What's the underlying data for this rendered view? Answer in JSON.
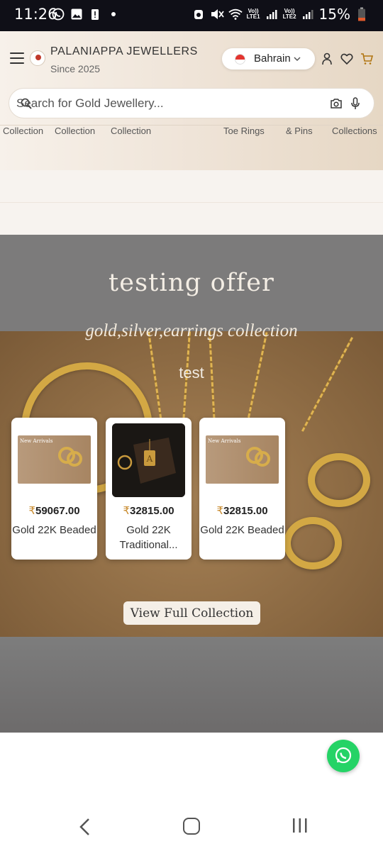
{
  "status_bar": {
    "time": "11:26",
    "battery": "15%",
    "sim1": "LTE1",
    "sim2": "LTE2",
    "volte": "Vo))"
  },
  "header": {
    "brand_name": "PALANIAPPA JEWELLERS",
    "brand_tagline": "Since 2025",
    "country": "Bahrain",
    "search_placeholder": "Search for Gold Jewellery..."
  },
  "categories": [
    "Collection",
    "Collection",
    "Collection",
    "Toe Rings",
    "& Pins",
    "Collections"
  ],
  "offer": {
    "title": "testing offer",
    "subtitle": "gold,silver,earrings collection",
    "tagline": "test",
    "button_label": "View Full Collection",
    "products": [
      {
        "price": "59067.00",
        "name": "Gold 22K Beaded",
        "thumb_label": "New Arrivals",
        "currency": "₹"
      },
      {
        "price": "32815.00",
        "name": "Gold 22K Traditional...",
        "thumb_label": "",
        "currency": "₹"
      },
      {
        "price": "32815.00",
        "name": "Gold 22K Beaded",
        "thumb_label": "New Arrivals",
        "currency": "₹"
      }
    ]
  },
  "colors": {
    "accent": "#c88a2c",
    "whatsapp": "#25d366",
    "offer_bg": "#7b7b7b"
  },
  "icons": [
    "menu-icon",
    "user-icon",
    "heart-icon",
    "cart-icon",
    "search-icon",
    "camera-icon",
    "mic-icon",
    "whatsapp-icon",
    "back-icon",
    "home-icon",
    "recent-apps-icon"
  ]
}
